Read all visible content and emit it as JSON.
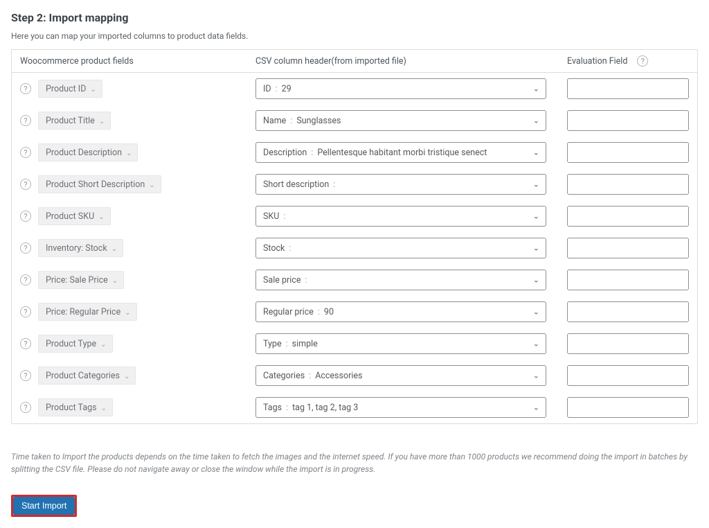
{
  "title": "Step 2: Import mapping",
  "intro": "Here you can map your imported columns to product data fields.",
  "columns": {
    "field_col": "Woocommerce product fields",
    "csv_col": "CSV column header(from imported file)",
    "eval_col": "Evaluation Field"
  },
  "rows": [
    {
      "field": "Product ID",
      "csv_label": "ID",
      "csv_value": "29"
    },
    {
      "field": "Product Title",
      "csv_label": "Name",
      "csv_value": "Sunglasses"
    },
    {
      "field": "Product Description",
      "csv_label": "Description",
      "csv_value": "Pellentesque habitant morbi tristique senect"
    },
    {
      "field": "Product Short Description",
      "csv_label": "Short description",
      "csv_value": ""
    },
    {
      "field": "Product SKU",
      "csv_label": "SKU",
      "csv_value": ""
    },
    {
      "field": "Inventory: Stock",
      "csv_label": "Stock",
      "csv_value": ""
    },
    {
      "field": "Price: Sale Price",
      "csv_label": "Sale price",
      "csv_value": ""
    },
    {
      "field": "Price: Regular Price",
      "csv_label": "Regular price",
      "csv_value": "90"
    },
    {
      "field": "Product Type",
      "csv_label": "Type",
      "csv_value": "simple"
    },
    {
      "field": "Product Categories",
      "csv_label": "Categories",
      "csv_value": "Accessories"
    },
    {
      "field": "Product Tags",
      "csv_label": "Tags",
      "csv_value": "tag 1, tag 2, tag 3"
    }
  ],
  "footnote": "Time taken to Import the products depends on the time taken to fetch the images and the internet speed. If you have more than 1000 products we recommend doing the import in batches by splitting the CSV file. Please do not navigate away or close the window while the import is in progress.",
  "start_button": "Start Import"
}
